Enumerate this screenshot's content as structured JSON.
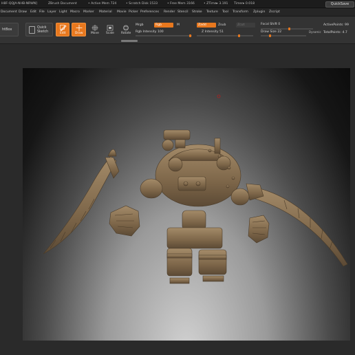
{
  "titlebar": {
    "doc_id": "H8F-QQJA-NHB-NRWN]",
    "app_title": "ZBrush Document",
    "active_mem": "• Active Mem 724",
    "scratch_disk": "• Scratch Disk 1533",
    "free_mem": "• Free Mem 3166",
    "ztime": "• ZTime▸ 3.191",
    "timer": "Timer▸ 0.018",
    "quicksave": "QuickSave"
  },
  "menu": [
    "Document",
    "Draw",
    "Edit",
    "File",
    "Layer",
    "Light",
    "Macro",
    "Marker",
    "Material",
    "Movie",
    "Picker",
    "Preferences",
    "Render",
    "Stencil",
    "Stroke",
    "Texture",
    "Tool",
    "Transform",
    "Zplugin",
    "Zscript"
  ],
  "toolbar": {
    "lightbox": "htBox",
    "quick_sketch_1": "Quick",
    "quick_sketch_2": "Sketch",
    "edit": "Edit",
    "draw": "Draw",
    "move": "Move",
    "scale": "Scale",
    "rotate": "Rotate",
    "mrgb": "Mrgb",
    "rgb": "Rgb",
    "m": "M",
    "rgb_intensity": "Rgb Intensity 100",
    "zadd": "Zadd",
    "zsub": "Zsub",
    "zcut": "Zcut",
    "z_intensity": "Z Intensity 51",
    "focal_shift": "Focal Shift 0",
    "draw_size": "Draw Size 22",
    "dynamic": "Dynamic",
    "active_points": "ActivePoints: 99",
    "total_points": "TotalPoints: 4.7"
  },
  "colors": {
    "accent": "#e8781e",
    "background": "#2a2a2a",
    "model": "#8a7457"
  }
}
